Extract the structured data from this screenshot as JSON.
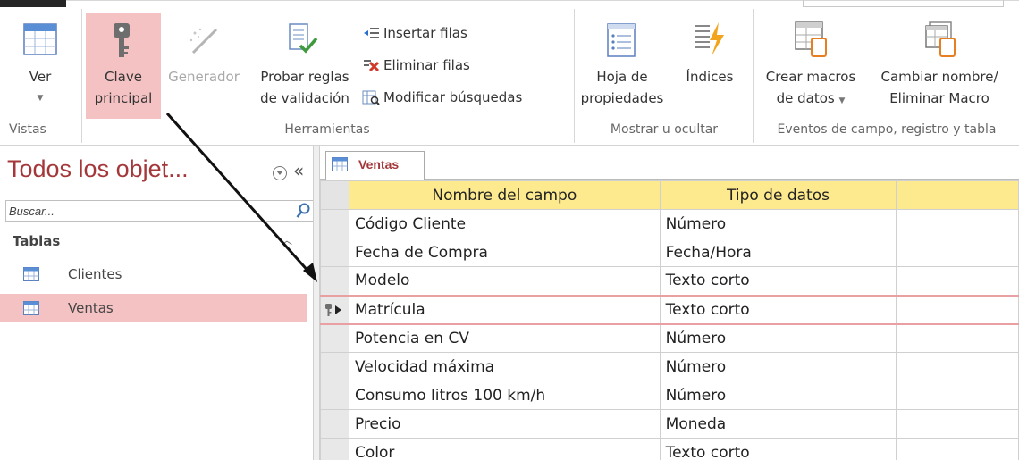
{
  "ribbon": {
    "views": {
      "ver_label": "Ver",
      "group_label": "Vistas"
    },
    "tools": {
      "clave_line1": "Clave",
      "clave_line2": "principal",
      "generador_label": "Generador",
      "probar_line1": "Probar reglas",
      "probar_line2": "de validación",
      "insertar_filas": "Insertar filas",
      "eliminar_filas": "Eliminar filas",
      "modificar_busquedas": "Modificar búsquedas",
      "group_label": "Herramientas"
    },
    "show_hide": {
      "hoja_line1": "Hoja de",
      "hoja_line2": "propiedades",
      "indices_label": "Índices",
      "group_label": "Mostrar u ocultar"
    },
    "events": {
      "crear_line1": "Crear macros",
      "crear_line2": "de datos",
      "cambiar_line1": "Cambiar nombre/",
      "cambiar_line2": "Eliminar Macro",
      "group_label": "Eventos de campo, registro y tabla"
    }
  },
  "nav": {
    "title": "Todos los objet...",
    "collapse_glyph": "«",
    "search_placeholder": "Buscar...",
    "section": "Tablas",
    "items": [
      {
        "label": "Clientes",
        "selected": false
      },
      {
        "label": "Ventas",
        "selected": true
      }
    ]
  },
  "document": {
    "tab_label": "Ventas",
    "columns": [
      "Nombre del campo",
      "Tipo de datos",
      ""
    ],
    "rows": [
      {
        "name": "Código Cliente",
        "type": "Número"
      },
      {
        "name": "Fecha de Compra",
        "type": "Fecha/Hora"
      },
      {
        "name": "Modelo",
        "type": "Texto corto"
      },
      {
        "name": "Matrícula",
        "type": "Texto corto"
      },
      {
        "name": "Potencia en CV",
        "type": "Número"
      },
      {
        "name": "Velocidad máxima",
        "type": "Número"
      },
      {
        "name": "Consumo litros 100 km/h",
        "type": "Número"
      },
      {
        "name": "Precio",
        "type": "Moneda"
      },
      {
        "name": "Color",
        "type": "Texto corto"
      }
    ],
    "primary_key_row": 3
  },
  "colors": {
    "accent": "#a4373a",
    "highlight": "#f4c2c2",
    "header_bg": "#fde98e"
  }
}
